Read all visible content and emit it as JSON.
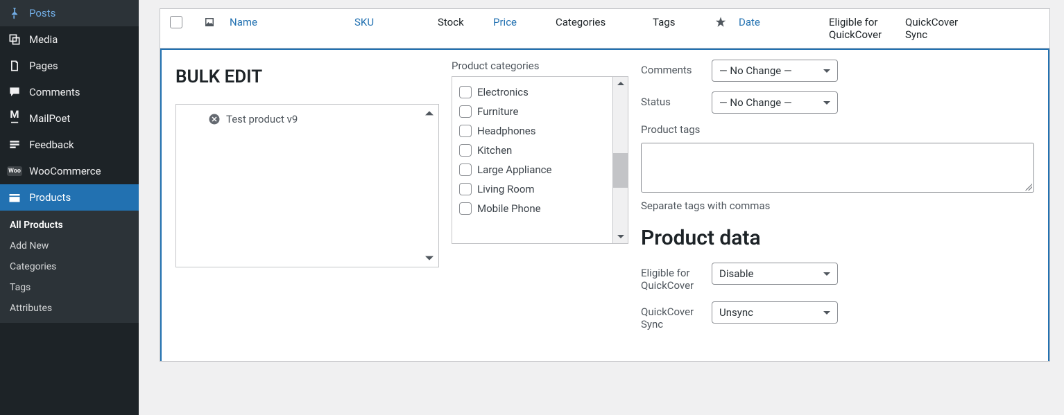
{
  "sidebar": {
    "items": [
      {
        "label": "Posts"
      },
      {
        "label": "Media"
      },
      {
        "label": "Pages"
      },
      {
        "label": "Comments"
      },
      {
        "label": "MailPoet"
      },
      {
        "label": "Feedback"
      },
      {
        "label": "WooCommerce"
      },
      {
        "label": "Products"
      }
    ],
    "submenu": [
      {
        "label": "All Products"
      },
      {
        "label": "Add New"
      },
      {
        "label": "Categories"
      },
      {
        "label": "Tags"
      },
      {
        "label": "Attributes"
      }
    ]
  },
  "columns": {
    "name": "Name",
    "sku": "SKU",
    "stock": "Stock",
    "price": "Price",
    "categories": "Categories",
    "tags": "Tags",
    "date": "Date",
    "eligible": "Eligible for QuickCover",
    "qsync": "QuickCover Sync"
  },
  "bulk_edit": {
    "title": "BULK EDIT",
    "product": "Test product v9",
    "categories_label": "Product categories",
    "categories": [
      "Electronics",
      "Furniture",
      "Headphones",
      "Kitchen",
      "Large Appliance",
      "Living Room",
      "Mobile Phone"
    ],
    "comments_label": "Comments",
    "status_label": "Status",
    "no_change": "— No Change —",
    "tags_label": "Product tags",
    "tags_hint": "Separate tags with commas",
    "product_data_title": "Product data",
    "eligible_label": "Eligible for QuickCover",
    "eligible_value": "Disable",
    "qsync_label": "QuickCover Sync",
    "qsync_value": "Unsync"
  }
}
